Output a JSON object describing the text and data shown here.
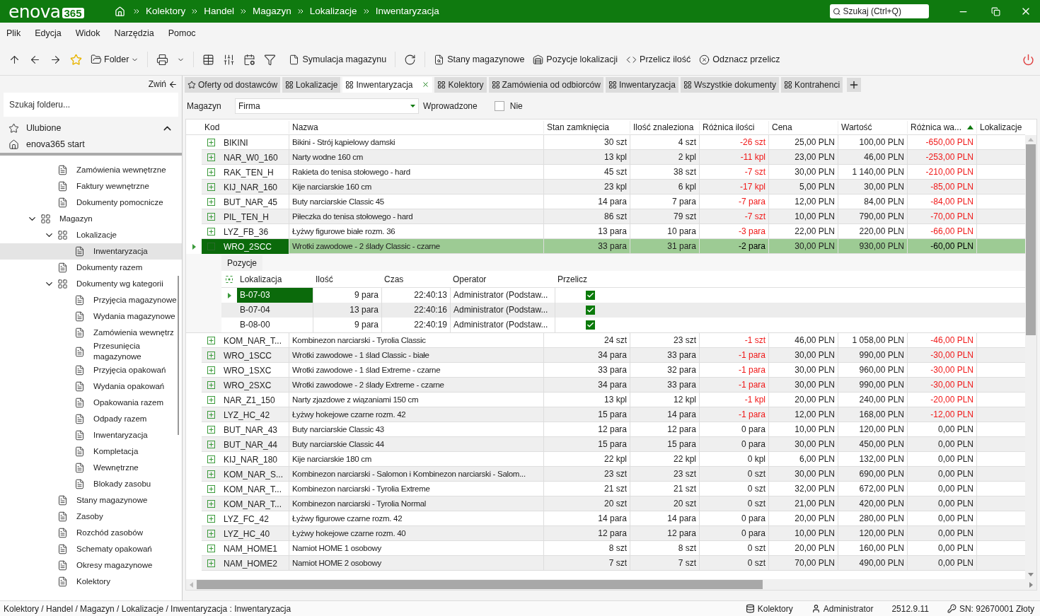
{
  "title_bar": {
    "logo": {
      "name": "enova",
      "badge": "365"
    },
    "breadcrumb": [
      "Kolektory",
      "Handel",
      "Magazyn",
      "Lokalizacje",
      "Inwentaryzacja"
    ],
    "search": {
      "placeholder": "Szukaj (Ctrl+Q)"
    }
  },
  "menu": [
    "Plik",
    "Edycja",
    "Widok",
    "Narzędzia",
    "Pomoc"
  ],
  "toolbar": {
    "folder_button": "Folder",
    "buttons": [
      "Symulacja magazynu",
      "Stany magazynowe",
      "Pozycje lokalizacji",
      "Przelicz ilość",
      "Odznacz przelicz"
    ]
  },
  "sidebar": {
    "collapse": "Zwiń",
    "search": {
      "placeholder": "Szukaj folderu..."
    },
    "favorites": {
      "label": "Ulubione",
      "expanded": true
    },
    "start": "enova365 start",
    "partial_items": [
      {
        "label": "Zamówienia wewnętrzne"
      },
      {
        "label": "Faktury wewnętrzne"
      },
      {
        "label": "Dokumenty pomocnicze"
      }
    ],
    "tree": [
      {
        "label": "Magazyn",
        "expanded": true,
        "selected": false,
        "children": [
          {
            "label": "Lokalizacje",
            "expanded": true,
            "selected": false,
            "children": [
              {
                "label": "Inwentaryzacja",
                "selected": true
              }
            ]
          },
          {
            "label": "Dokumenty razem",
            "selected": false
          },
          {
            "label": "Dokumenty wg kategorii",
            "expanded": true,
            "selected": false,
            "children": [
              {
                "label": "Przyjęcia magazynowe",
                "selected": false
              },
              {
                "label": "Wydania magazynowe",
                "selected": false
              },
              {
                "label": "Zamówienia wewnętrz",
                "selected": false
              },
              {
                "label": "Przesunięcia magazynowe",
                "selected": false
              },
              {
                "label": "Przyjęcia opakowań",
                "selected": false
              },
              {
                "label": "Wydania opakowań",
                "selected": false
              },
              {
                "label": "Opakowania razem",
                "selected": false
              },
              {
                "label": "Odpady razem",
                "selected": false
              },
              {
                "label": "Inwentaryzacja",
                "selected": false
              },
              {
                "label": "Kompletacja",
                "selected": false
              },
              {
                "label": "Wewnętrzne",
                "selected": false
              },
              {
                "label": "Blokady zasobu",
                "selected": false
              }
            ]
          },
          {
            "label": "Stany magazynowe",
            "selected": false
          },
          {
            "label": "Zasoby",
            "selected": false
          },
          {
            "label": "Rozchód zasobów",
            "selected": false
          },
          {
            "label": "Schematy opakowań",
            "selected": false
          },
          {
            "label": "Okresy magazynowe",
            "selected": false
          },
          {
            "label": "Kolektory",
            "selected": false
          }
        ]
      }
    ]
  },
  "tabs": [
    {
      "label": "Oferty od dostawców",
      "selected": false
    },
    {
      "label": "Lokalizacje",
      "selected": false
    },
    {
      "label": "Inwentaryzacja",
      "selected": true
    },
    {
      "label": "Kolektory",
      "selected": false
    },
    {
      "label": "Zamówienia od odbiorców",
      "selected": false
    },
    {
      "label": "Inwentaryzacja",
      "selected": false
    },
    {
      "label": "Wszystkie dokumenty",
      "selected": false
    },
    {
      "label": "Kontrahenci",
      "selected": false
    }
  ],
  "filter": {
    "warehouse_label": "Magazyn",
    "warehouse_value": "Firma",
    "entered_label": "Wprowadzone",
    "entered_checked": false,
    "entered_value": "Nie"
  },
  "table": {
    "columns": [
      {
        "label": "Kod",
        "sorted": false
      },
      {
        "label": "Nazwa",
        "sorted": false
      },
      {
        "label": "Stan zamknięcia",
        "sorted": false
      },
      {
        "label": "Ilość znaleziona",
        "sorted": false
      },
      {
        "label": "Różnica ilości",
        "sorted": false
      },
      {
        "label": "Cena",
        "sorted": false
      },
      {
        "label": "Wartość",
        "sorted": false
      },
      {
        "label": "Różnica wa...",
        "sorted": true
      },
      {
        "label": "Lokalizacje",
        "sorted": false
      }
    ],
    "rows": [
      {
        "code": "BIKINI",
        "name": "Bikini - Strój kąpielowy damski",
        "closing": "30 szt",
        "found": "4 szt",
        "qty_diff": "-26 szt",
        "price": "25,00 PLN",
        "value": "100,00 PLN",
        "value_diff": "-650,00 PLN",
        "shortage": true,
        "selected": false,
        "expanded": false
      },
      {
        "code": "NAR_W0_160",
        "name": "Narty wodne 160 cm",
        "closing": "13 kpl",
        "found": "2 kpl",
        "qty_diff": "-11 kpl",
        "price": "23,00 PLN",
        "value": "46,00 PLN",
        "value_diff": "-253,00 PLN",
        "shortage": true,
        "selected": false,
        "expanded": false
      },
      {
        "code": "RAK_TEN_H",
        "name": "Rakieta do tenisa stołowego - hard",
        "closing": "45 szt",
        "found": "38 szt",
        "qty_diff": "-7 szt",
        "price": "30,00 PLN",
        "value": "1 140,00 PLN",
        "value_diff": "-210,00 PLN",
        "shortage": true,
        "selected": false,
        "expanded": false
      },
      {
        "code": "KIJ_NAR_160",
        "name": "Kije narciarskie 160 cm",
        "closing": "23 kpl",
        "found": "6 kpl",
        "qty_diff": "-17 kpl",
        "price": "5,00 PLN",
        "value": "30,00 PLN",
        "value_diff": "-85,00 PLN",
        "shortage": true,
        "selected": false,
        "expanded": false
      },
      {
        "code": "BUT_NAR_45",
        "name": "Buty narciarskie Classic 45",
        "closing": "14 para",
        "found": "7 para",
        "qty_diff": "-7 para",
        "price": "12,00 PLN",
        "value": "84,00 PLN",
        "value_diff": "-84,00 PLN",
        "shortage": true,
        "selected": false,
        "expanded": false
      },
      {
        "code": "PIL_TEN_H",
        "name": "Piłeczka do tenisa stołowego - hard",
        "closing": "86 szt",
        "found": "79 szt",
        "qty_diff": "-7 szt",
        "price": "10,00 PLN",
        "value": "790,00 PLN",
        "value_diff": "-70,00 PLN",
        "shortage": true,
        "selected": false,
        "expanded": false
      },
      {
        "code": "LYZ_FB_36",
        "name": "Łyżwy figurowe białe rozm. 36",
        "closing": "13 para",
        "found": "10 para",
        "qty_diff": "-3 para",
        "price": "22,00 PLN",
        "value": "220,00 PLN",
        "value_diff": "-66,00 PLN",
        "shortage": true,
        "selected": false,
        "expanded": false
      },
      {
        "code": "WRO_2SCC",
        "name": "Wrotki zawodowe - 2 ślady Classic - czarne",
        "closing": "33 para",
        "found": "31 para",
        "qty_diff": "-2 para",
        "price": "30,00 PLN",
        "value": "930,00 PLN",
        "value_diff": "-60,00 PLN",
        "shortage": true,
        "selected": true,
        "expanded": true,
        "details": {
          "tab": "Pozycje",
          "columns": [
            "Lokalizacja",
            "Ilość",
            "Czas",
            "Operator",
            "Przelicz"
          ],
          "positions": [
            {
              "location": "B-07-03",
              "qty": "9 para",
              "time": "22:40:13",
              "operator": "Administrator (Podstaw...",
              "recount": true,
              "selected": true
            },
            {
              "location": "B-07-04",
              "qty": "13 para",
              "time": "22:40:16",
              "operator": "Administrator (Podstaw...",
              "recount": true,
              "selected": false
            },
            {
              "location": "B-08-00",
              "qty": "9 para",
              "time": "22:40:19",
              "operator": "Administrator (Podstaw...",
              "recount": true,
              "selected": false
            }
          ]
        }
      },
      {
        "code": "KOM_NAR_T...",
        "name": "Kombinezon narciarski - Tyrolia Classic",
        "closing": "24 szt",
        "found": "23 szt",
        "qty_diff": "-1 szt",
        "price": "46,00 PLN",
        "value": "1 058,00 PLN",
        "value_diff": "-46,00 PLN",
        "shortage": true,
        "selected": false,
        "expanded": false
      },
      {
        "code": "WRO_1SCC",
        "name": "Wrotki zawodowe - 1 ślad Classic - białe",
        "closing": "34 para",
        "found": "33 para",
        "qty_diff": "-1 para",
        "price": "30,00 PLN",
        "value": "990,00 PLN",
        "value_diff": "-30,00 PLN",
        "shortage": true,
        "selected": false,
        "expanded": false
      },
      {
        "code": "WRO_1SXC",
        "name": "Wrotki zawodowe - 1 ślad Extreme - czarne",
        "closing": "33 para",
        "found": "32 para",
        "qty_diff": "-1 para",
        "price": "30,00 PLN",
        "value": "960,00 PLN",
        "value_diff": "-30,00 PLN",
        "shortage": true,
        "selected": false,
        "expanded": false
      },
      {
        "code": "WRO_2SXC",
        "name": "Wrotki zawodowe - 2 ślady Extreme - czarne",
        "closing": "34 para",
        "found": "33 para",
        "qty_diff": "-1 para",
        "price": "30,00 PLN",
        "value": "990,00 PLN",
        "value_diff": "-30,00 PLN",
        "shortage": true,
        "selected": false,
        "expanded": false
      },
      {
        "code": "NAR_Z1_150",
        "name": "Narty zjazdowe z wiązaniami 150 cm",
        "closing": "13 kpl",
        "found": "12 kpl",
        "qty_diff": "-1 kpl",
        "price": "20,00 PLN",
        "value": "240,00 PLN",
        "value_diff": "-20,00 PLN",
        "shortage": true,
        "selected": false,
        "expanded": false
      },
      {
        "code": "LYZ_HC_42",
        "name": "Łyżwy hokejowe czarne rozm. 42",
        "closing": "15 para",
        "found": "14 para",
        "qty_diff": "-1 para",
        "price": "12,00 PLN",
        "value": "168,00 PLN",
        "value_diff": "-12,00 PLN",
        "shortage": true,
        "selected": false,
        "expanded": false
      },
      {
        "code": "BUT_NAR_43",
        "name": "Buty narciarskie Classic 43",
        "closing": "12 para",
        "found": "12 para",
        "qty_diff": "0 para",
        "price": "10,00 PLN",
        "value": "120,00 PLN",
        "value_diff": "0,00 PLN",
        "shortage": false,
        "selected": false,
        "expanded": false
      },
      {
        "code": "BUT_NAR_44",
        "name": "Buty narciarskie Classic 44",
        "closing": "15 para",
        "found": "15 para",
        "qty_diff": "0 para",
        "price": "30,00 PLN",
        "value": "450,00 PLN",
        "value_diff": "0,00 PLN",
        "shortage": false,
        "selected": false,
        "expanded": false
      },
      {
        "code": "KIJ_NAR_180",
        "name": "Kije narciarskie 180 cm",
        "closing": "22 kpl",
        "found": "22 kpl",
        "qty_diff": "0 kpl",
        "price": "6,00 PLN",
        "value": "132,00 PLN",
        "value_diff": "0,00 PLN",
        "shortage": false,
        "selected": false,
        "expanded": false
      },
      {
        "code": "KOM_NAR_S...",
        "name": "Kombinezon narciarski - Salomon i Kombinezon narciarski - Salom...",
        "closing": "23 szt",
        "found": "23 szt",
        "qty_diff": "0 szt",
        "price": "30,00 PLN",
        "value": "690,00 PLN",
        "value_diff": "0,00 PLN",
        "shortage": false,
        "selected": false,
        "expanded": false
      },
      {
        "code": "KOM_NAR_T...",
        "name": "Kombinezon narciarski - Tyrolia Extreme",
        "closing": "21 szt",
        "found": "21 szt",
        "qty_diff": "0 szt",
        "price": "32,00 PLN",
        "value": "672,00 PLN",
        "value_diff": "0,00 PLN",
        "shortage": false,
        "selected": false,
        "expanded": false
      },
      {
        "code": "KOM_NAR_T...",
        "name": "Kombinezon narciarski - Tyrolia Normal",
        "closing": "20 szt",
        "found": "20 szt",
        "qty_diff": "0 szt",
        "price": "21,00 PLN",
        "value": "420,00 PLN",
        "value_diff": "0,00 PLN",
        "shortage": false,
        "selected": false,
        "expanded": false
      },
      {
        "code": "LYZ_FC_42",
        "name": "Łyżwy figurowe czarne rozm. 42",
        "closing": "14 para",
        "found": "14 para",
        "qty_diff": "0 para",
        "price": "20,00 PLN",
        "value": "280,00 PLN",
        "value_diff": "0,00 PLN",
        "shortage": false,
        "selected": false,
        "expanded": false
      },
      {
        "code": "LYZ_HC_40",
        "name": "Łyżwy hokejowe czarne rozm. 40",
        "closing": "12 para",
        "found": "12 para",
        "qty_diff": "0 para",
        "price": "10,00 PLN",
        "value": "120,00 PLN",
        "value_diff": "0,00 PLN",
        "shortage": false,
        "selected": false,
        "expanded": false
      },
      {
        "code": "NAM_HOME1",
        "name": "Namiot HOME 1 osobowy",
        "closing": "8 szt",
        "found": "8 szt",
        "qty_diff": "0 szt",
        "price": "20,00 PLN",
        "value": "160,00 PLN",
        "value_diff": "0,00 PLN",
        "shortage": false,
        "selected": false,
        "expanded": false
      },
      {
        "code": "NAM_HOME2",
        "name": "Namiot HOME 2 osobowy",
        "closing": "7 szt",
        "found": "7 szt",
        "qty_diff": "0 szt",
        "price": "70,00 PLN",
        "value": "490,00 PLN",
        "value_diff": "0,00 PLN",
        "shortage": false,
        "selected": false,
        "expanded": false
      }
    ]
  },
  "status_bar": {
    "path": "Kolektory / Handel / Magazyn / Lokalizacje / Inwentaryzacja : Inwentaryzacja",
    "database": "Kolektory",
    "user": "Administrator",
    "version": "2512.9.11",
    "serial": "SN: 92670001 Złoty"
  }
}
